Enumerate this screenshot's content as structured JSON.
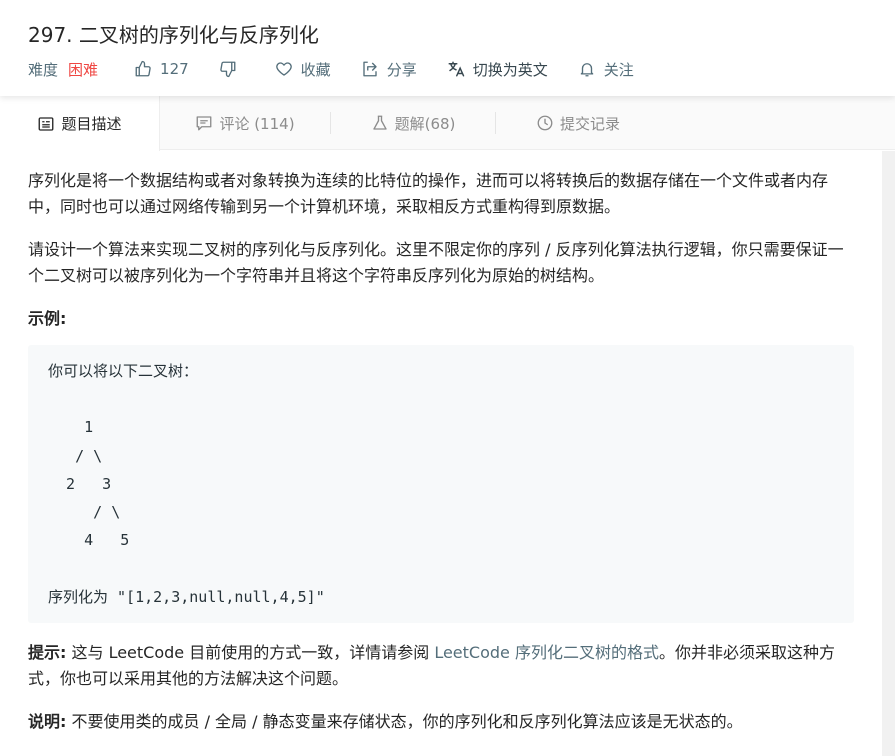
{
  "problem": {
    "title": "297. 二叉树的序列化与反序列化",
    "difficulty_label": "难度",
    "difficulty_value": "困难",
    "likes": "127",
    "favorite_label": "收藏",
    "share_label": "分享",
    "translate_label": "切换为英文",
    "follow_label": "关注"
  },
  "tabs": [
    {
      "label": "题目描述",
      "icon": "description-icon",
      "active": true
    },
    {
      "label": "评论 (114)",
      "icon": "comment-icon",
      "active": false
    },
    {
      "label": "题解(68)",
      "icon": "solution-flask-icon",
      "active": false
    },
    {
      "label": "提交记录",
      "icon": "clock-icon",
      "active": false
    }
  ],
  "description": {
    "para1": "序列化是将一个数据结构或者对象转换为连续的比特位的操作，进而可以将转换后的数据存储在一个文件或者内存中，同时也可以通过网络传输到另一个计算机环境，采取相反方式重构得到原数据。",
    "para2": "请设计一个算法来实现二叉树的序列化与反序列化。这里不限定你的序列 / 反序列化算法执行逻辑，你只需要保证一个二叉树可以被序列化为一个字符串并且将这个字符串反序列化为原始的树结构。",
    "example_label": "示例:",
    "code_lines": [
      "你可以将以下二叉树：",
      "",
      "    1",
      "   / \\",
      "  2   3",
      "     / \\",
      "    4   5",
      "",
      "序列化为 \"[1,2,3,null,null,4,5]\""
    ],
    "hint_label": "提示:",
    "hint_text_before": " 这与 LeetCode 目前使用的方式一致，详情请参阅 ",
    "hint_link": "LeetCode 序列化二叉树的格式",
    "hint_text_after": "。你并非必须采取这种方式，你也可以采用其他的方法解决这个问题。",
    "note_label": "说明:",
    "note_text": " 不要使用类的成员 / 全局 / 静态变量来存储状态，你的序列化和反序列化算法应该是无状态的。"
  },
  "colors": {
    "difficulty_hard": "#ef4743",
    "meta_text": "#546e7a",
    "code_bg": "#f7f9fa"
  }
}
